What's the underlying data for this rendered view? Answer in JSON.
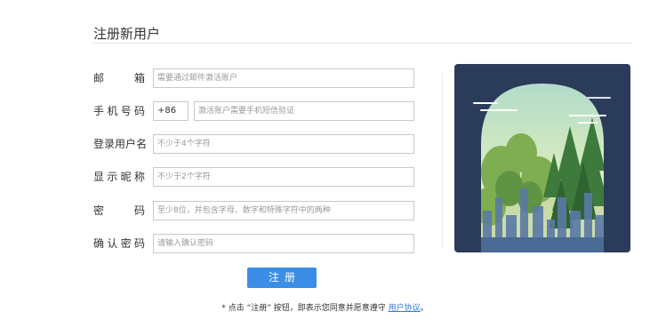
{
  "title": "注册新用户",
  "form": {
    "email": {
      "label_chars": [
        "邮",
        "箱"
      ],
      "placeholder": "需要通过邮件激活账户"
    },
    "phone": {
      "label_chars": [
        "手",
        "机",
        "号",
        "码"
      ],
      "country_code": "+86",
      "placeholder": "激活账户需要手机短信验证"
    },
    "username": {
      "label_chars": [
        "登",
        "录",
        "用",
        "户",
        "名"
      ],
      "placeholder": "不少于4个字符"
    },
    "nickname": {
      "label_chars": [
        "显",
        "示",
        "昵",
        "称"
      ],
      "placeholder": "不少于2个字符"
    },
    "password": {
      "label_chars": [
        "密",
        "码"
      ],
      "placeholder": "至少8位，并包含字母、数字和特殊字符中的两种"
    },
    "confirm": {
      "label_chars": [
        "确",
        "认",
        "密",
        "码"
      ],
      "placeholder": "请输入确认密码"
    }
  },
  "register_label": "注册",
  "agreement": {
    "star": "*",
    "text": "点击 “注册” 按钮，即表示您同意并愿意遵守",
    "link": "用户协议",
    "end": "。"
  },
  "colors": {
    "accent": "#3a8ee6",
    "illustration_bg": "#2b3b5a"
  }
}
